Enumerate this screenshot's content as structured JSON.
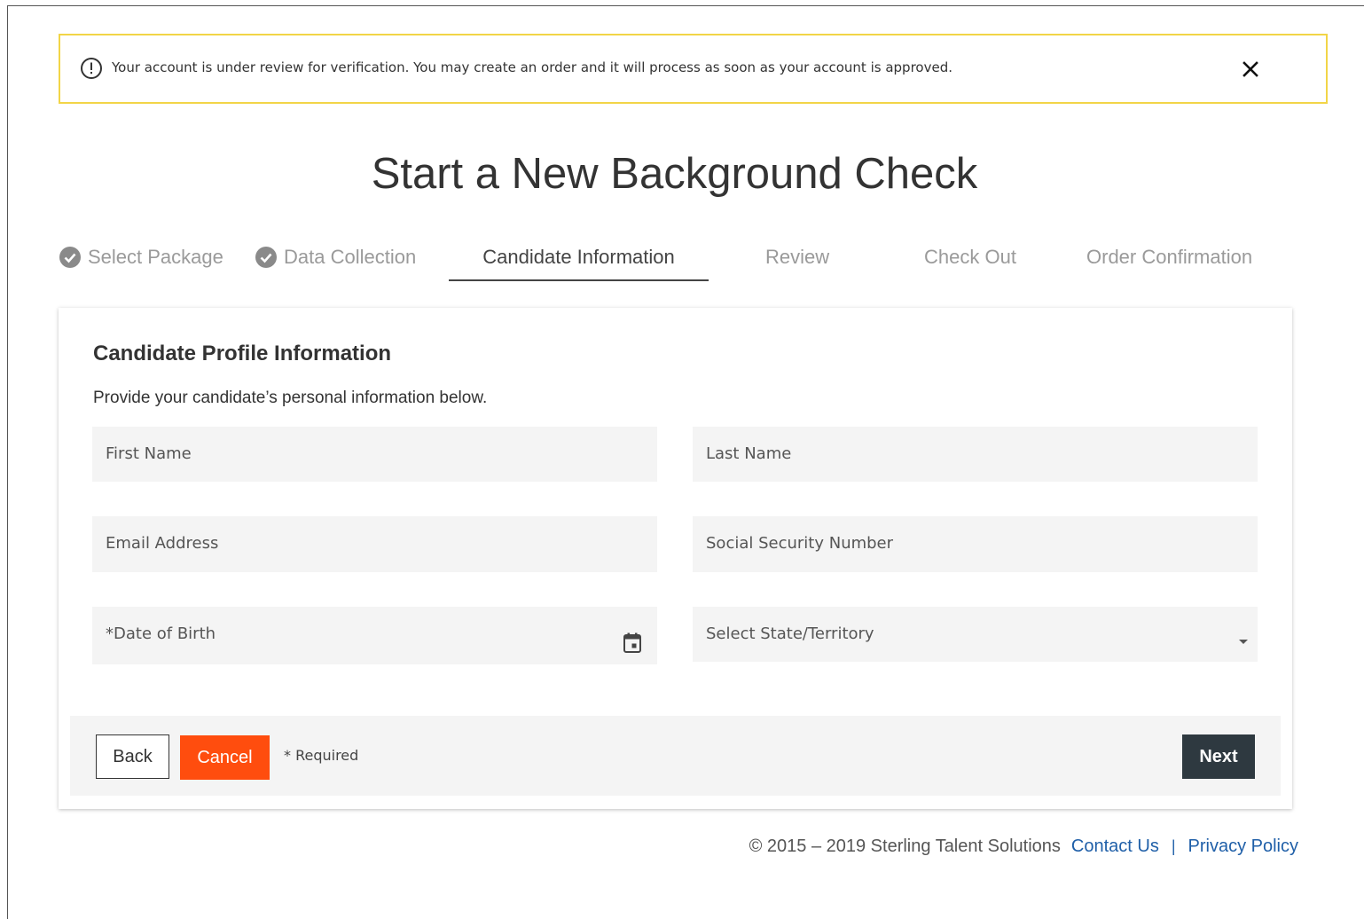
{
  "alert": {
    "message": "Your account is under review for verification. You may create an order and it will process as soon as your account is approved.",
    "icon": "exclamation-circle-icon",
    "close_icon": "close-icon",
    "border_color": "#f2d547"
  },
  "page_title": "Start a New Background Check",
  "steps": [
    {
      "label": "Select Package",
      "state": "complete"
    },
    {
      "label": "Data Collection",
      "state": "complete"
    },
    {
      "label": "Candidate Information",
      "state": "active"
    },
    {
      "label": "Review",
      "state": "pending"
    },
    {
      "label": "Check Out",
      "state": "pending"
    },
    {
      "label": "Order Confirmation",
      "state": "pending"
    }
  ],
  "form": {
    "title": "Candidate Profile Information",
    "subtitle": "Provide your candidate’s personal information below.",
    "first_name": {
      "placeholder": "First Name",
      "value": ""
    },
    "last_name": {
      "placeholder": "Last Name",
      "value": ""
    },
    "email": {
      "placeholder": "Email Address",
      "value": ""
    },
    "ssn": {
      "placeholder": "Social Security Number",
      "value": ""
    },
    "dob": {
      "placeholder": "*Date of Birth",
      "value": "",
      "icon": "calendar-icon"
    },
    "state": {
      "placeholder": "Select State/Territory",
      "value": "",
      "icon": "caret-down-icon"
    }
  },
  "actions": {
    "back": "Back",
    "cancel": "Cancel",
    "required_note": "* Required",
    "next": "Next",
    "cancel_color": "#ff4d0e",
    "next_color": "#2e3940"
  },
  "footer": {
    "copyright": "© 2015 – 2019 Sterling Talent Solutions",
    "contact": "Contact Us",
    "separator": "|",
    "privacy": "Privacy Policy",
    "link_color": "#1f5fa8"
  }
}
